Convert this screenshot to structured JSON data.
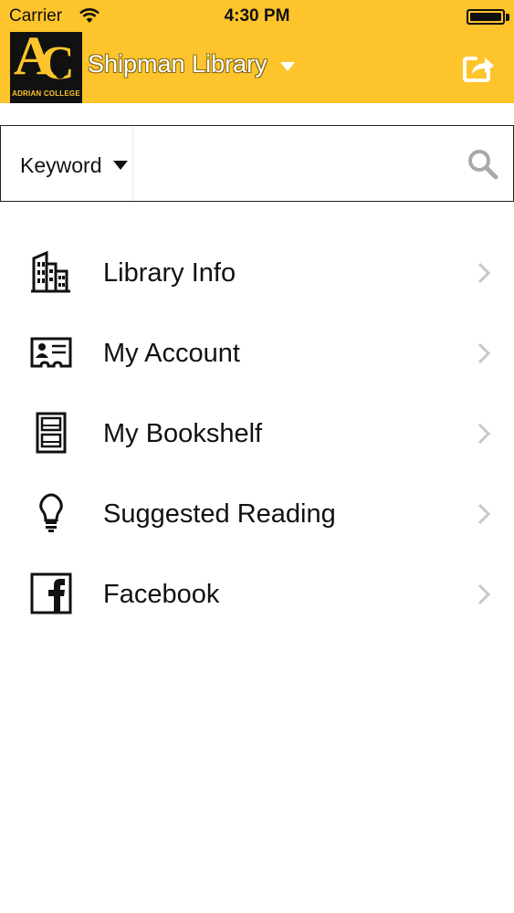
{
  "status_bar": {
    "carrier": "Carrier",
    "time": "4:30 PM"
  },
  "header": {
    "logo": {
      "letters_a": "A",
      "letters_c": "C",
      "caption": "ADRIAN COLLEGE"
    },
    "title": "Shipman Library",
    "background_color": "#fdc42b",
    "share_icon": "share-icon"
  },
  "search": {
    "scope_label": "Keyword",
    "value": "",
    "icon": "search-icon"
  },
  "menu": {
    "items": [
      {
        "label": "Library Info",
        "icon": "building-icon"
      },
      {
        "label": "My Account",
        "icon": "id-card-icon"
      },
      {
        "label": "My Bookshelf",
        "icon": "bookshelf-icon"
      },
      {
        "label": "Suggested Reading",
        "icon": "lightbulb-icon"
      },
      {
        "label": "Facebook",
        "icon": "facebook-icon"
      }
    ]
  }
}
